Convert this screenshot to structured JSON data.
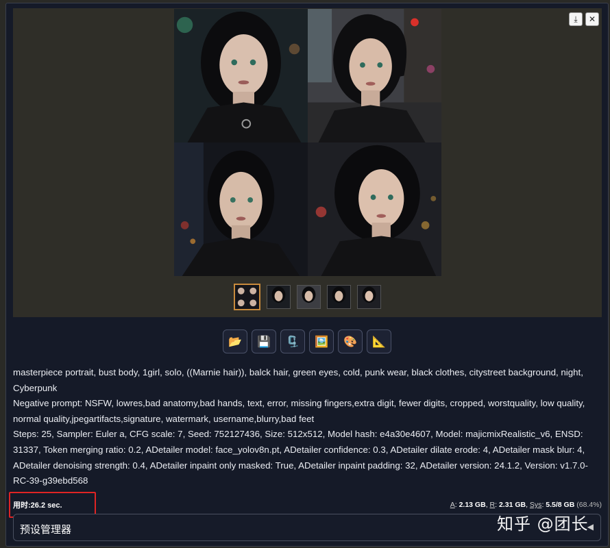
{
  "gallery": {
    "download_icon": "download-icon",
    "close_icon": "close-icon",
    "thumbnails": [
      {
        "id": 1,
        "selected": true
      },
      {
        "id": 2,
        "selected": false
      },
      {
        "id": 3,
        "selected": false
      },
      {
        "id": 4,
        "selected": false
      },
      {
        "id": 5,
        "selected": false
      }
    ]
  },
  "toolbar": {
    "buttons": [
      {
        "icon": "folder-icon",
        "glyph": "📂"
      },
      {
        "icon": "save-icon",
        "glyph": "💾"
      },
      {
        "icon": "zip-icon",
        "glyph": "🗜️"
      },
      {
        "icon": "image-icon",
        "glyph": "🖼️"
      },
      {
        "icon": "palette-icon",
        "glyph": "🎨"
      },
      {
        "icon": "ruler-icon",
        "glyph": "📐"
      }
    ]
  },
  "info": {
    "prompt": "masterpiece portrait, bust body, 1girl, solo, ((Marnie hair)), balck hair, green eyes, cold, punk wear, black clothes, citystreet background, night, Cyberpunk",
    "negative_prompt": "Negative prompt: NSFW, lowres,bad anatomy,bad hands, text, error, missing fingers,extra digit, fewer digits, cropped, worstquality, low quality, normal quality,jpegartifacts,signature, watermark, username,blurry,bad feet",
    "params": "Steps: 25, Sampler: Euler a, CFG scale: 7, Seed: 752127436, Size: 512x512, Model hash: e4a30e4607, Model: majicmixRealistic_v6, ENSD: 31337, Token merging ratio: 0.2, ADetailer model: face_yolov8n.pt, ADetailer confidence: 0.3, ADetailer dilate erode: 4, ADetailer mask blur: 4, ADetailer denoising strength: 0.4, ADetailer inpaint only masked: True, ADetailer inpaint padding: 32, ADetailer version: 24.1.2, Version: v1.7.0-RC-39-g39ebd568"
  },
  "status": {
    "time_label": "用时:",
    "time_value": "26.2 sec.",
    "mem_a_key": "A",
    "mem_a": "2.13 GB",
    "mem_r_key": "R",
    "mem_r": "2.31 GB",
    "mem_sys_key": "Sys",
    "mem_sys": "5.5/8 GB",
    "mem_pct": "(68.4%)"
  },
  "preset": {
    "label": "预设管理器",
    "arrow": "◀"
  },
  "watermark": "知乎 @团长",
  "colors": {
    "highlight": "#e02424",
    "thumb_selected": "#c98b3c"
  }
}
